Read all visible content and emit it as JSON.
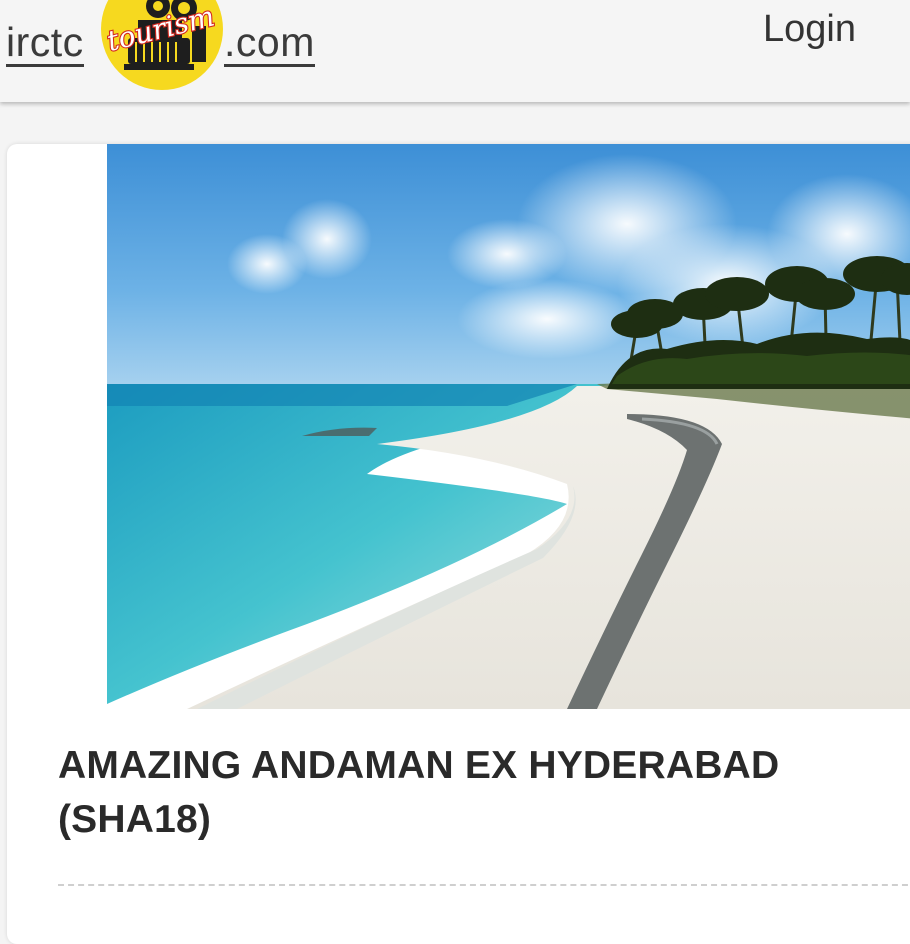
{
  "header": {
    "logo": {
      "left_text": "irctc",
      "right_text": ".com",
      "badge_text": "tourism",
      "badge_color": "#f6d91f",
      "script_color": "#d4281e"
    },
    "login_label": "Login"
  },
  "package": {
    "title": "AMAZING ANDAMAN EX HYDERABAD (SHA18)",
    "image_subject": "tropical beach with turquoise sea, white sand and palm trees"
  }
}
